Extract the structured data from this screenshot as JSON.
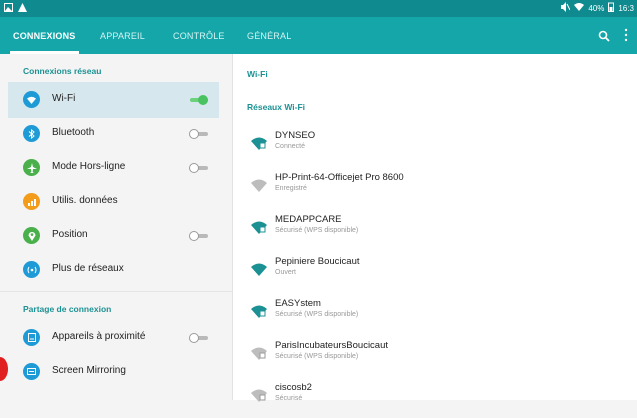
{
  "status": {
    "battery": "40%",
    "time": "16:3"
  },
  "tabs": [
    "CONNEXIONS",
    "APPAREIL",
    "CONTRÔLE",
    "GÉNÉRAL"
  ],
  "left": {
    "section1": "Connexions réseau",
    "items": [
      {
        "label": "Wi-Fi",
        "color": "#1e9bd7",
        "toggle": "on"
      },
      {
        "label": "Bluetooth",
        "color": "#1e9bd7",
        "toggle": "off"
      },
      {
        "label": "Mode Hors-ligne",
        "color": "#49b04b",
        "toggle": "off"
      },
      {
        "label": "Utilis. données",
        "color": "#f39b1b",
        "toggle": ""
      },
      {
        "label": "Position",
        "color": "#49b04b",
        "toggle": "off"
      },
      {
        "label": "Plus de réseaux",
        "color": "#1e9bd7",
        "toggle": ""
      }
    ],
    "section2": "Partage de connexion",
    "items2": [
      {
        "label": "Appareils à proximité",
        "color": "#1e9bd7",
        "toggle": "off"
      },
      {
        "label": "Screen Mirroring",
        "color": "#1e9bd7",
        "toggle": ""
      }
    ]
  },
  "right": {
    "title": "Wi-Fi",
    "subtitle": "Réseaux Wi-Fi",
    "networks": [
      {
        "name": "DYNSEO",
        "status": "Connecté",
        "locked": true,
        "active": true
      },
      {
        "name": "HP-Print-64-Officejet Pro 8600",
        "status": "Enregistré",
        "locked": false,
        "active": false
      },
      {
        "name": "MEDAPPCARE",
        "status": "Sécurisé (WPS disponible)",
        "locked": true,
        "active": true
      },
      {
        "name": "Pepiniere Boucicaut",
        "status": "Ouvert",
        "locked": false,
        "active": true
      },
      {
        "name": "EASYstem",
        "status": "Sécurisé (WPS disponible)",
        "locked": true,
        "active": true
      },
      {
        "name": "ParisIncubateursBoucicaut",
        "status": "Sécurisé (WPS disponible)",
        "locked": true,
        "active": false
      },
      {
        "name": "ciscosb2",
        "status": "Sécurisé",
        "locked": true,
        "active": false
      }
    ]
  }
}
